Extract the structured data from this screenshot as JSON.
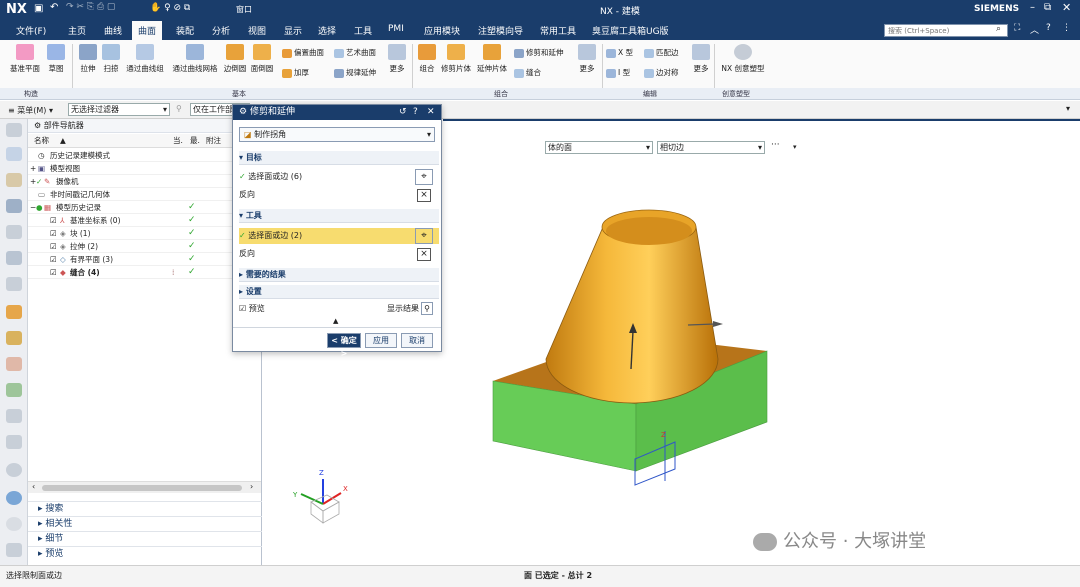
{
  "titlebar": {
    "app": "NX",
    "window_menu": "窗口",
    "title": "NX - 建模",
    "brand": "SIEMENS"
  },
  "menubar": {
    "file": "文件(F)",
    "items": [
      "主页",
      "曲线",
      "曲面",
      "装配",
      "分析",
      "视图",
      "显示",
      "选择",
      "工具",
      "PMI",
      "应用模块",
      "注塑模向导",
      "常用工具",
      "臭豆腐工具箱UG版"
    ],
    "active": "曲面",
    "search_placeholder": "搜索 (Ctrl+Space)"
  },
  "ribbon": {
    "construct": [
      "基准平面",
      "草图"
    ],
    "basic_large": [
      "拉伸",
      "扫掠",
      "通过曲线组",
      "通过曲线网格",
      "边倒圆",
      "面倒圆"
    ],
    "basic_small": [
      "偏置曲面",
      "艺术曲面",
      "加厚",
      "规律延伸",
      "更多"
    ],
    "combine": [
      "组合",
      "修剪片体",
      "延伸片体",
      "修剪和延伸",
      "缝合",
      "更多"
    ],
    "edit": [
      "X 型",
      "匹配边",
      "I 型",
      "边对称",
      "更多"
    ],
    "creative": [
      "NX 创意塑型"
    ],
    "groups": [
      "构造",
      "基本",
      "组合",
      "编辑",
      "创意塑型"
    ]
  },
  "cmdbar": {
    "menu": "菜单(M)",
    "filter": "无选择过滤器",
    "scope": "仅在工作部"
  },
  "navigator": {
    "title": "部件导航器",
    "columns": [
      "名称",
      "当.",
      "最.",
      "附注"
    ],
    "rows": [
      {
        "label": "历史记录建模模式",
        "check": false
      },
      {
        "label": "模型视图",
        "check": false
      },
      {
        "label": "摄像机",
        "check": false
      },
      {
        "label": "非时间戳记几何体",
        "check": false
      },
      {
        "label": "模型历史记录",
        "check": true
      },
      {
        "label": "基准坐标系 (0)",
        "check": true
      },
      {
        "label": "块 (1)",
        "check": true
      },
      {
        "label": "拉伸 (2)",
        "check": true
      },
      {
        "label": "有界平面 (3)",
        "check": true
      },
      {
        "label": "缝合 (4)",
        "check": true
      }
    ],
    "bottom_sections": [
      "搜索",
      "相关性",
      "细节",
      "预览"
    ]
  },
  "dialog": {
    "title": "修剪和延伸",
    "type_value": "制作拐角",
    "target_header": "目标",
    "target_select": "选择面或边 (6)",
    "reverse": "反向",
    "tool_header": "工具",
    "tool_select": "选择面或边 (2)",
    "reverse2": "反向",
    "result_header": "需要的结果",
    "settings_header": "设置",
    "preview": "预览",
    "show_result": "显示结果",
    "ok": "< 确定 >",
    "apply": "应用",
    "cancel": "取消"
  },
  "viewport": {
    "face_filter": "体的面",
    "edge_filter": "相切边"
  },
  "status": {
    "left": "选择限制面或边",
    "center": "面 已选定 - 总计 2"
  },
  "watermark": "公众号 · 大塚讲堂",
  "colors": {
    "accent": "#1a3d6b",
    "cone": "#f0a020",
    "block_side": "#66cc55",
    "highlight": "#f7dc6f"
  }
}
